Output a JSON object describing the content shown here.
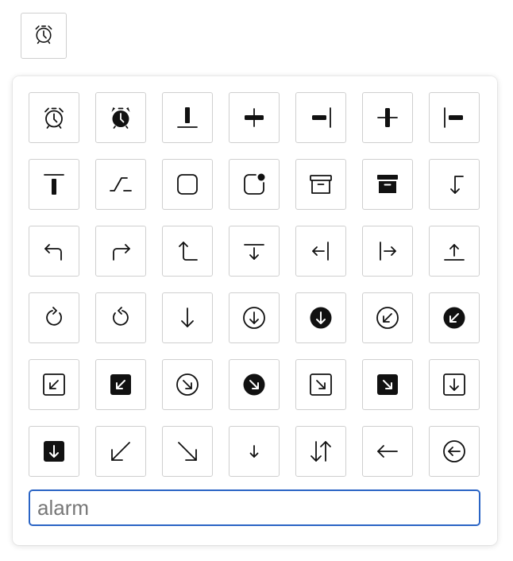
{
  "trigger": {
    "icon": "alarm-icon"
  },
  "search": {
    "placeholder": "alarm"
  },
  "icons": [
    "alarm",
    "alarm-fill",
    "align-bottom",
    "align-center",
    "align-end",
    "align-middle",
    "align-start",
    "align-top",
    "alt",
    "app",
    "app-indicator",
    "archive",
    "archive-fill",
    "arrow-90deg-down",
    "arrow-90deg-left",
    "arrow-90deg-right",
    "arrow-90deg-up",
    "arrow-bar-down",
    "arrow-bar-left",
    "arrow-bar-right",
    "arrow-bar-up",
    "arrow-clockwise",
    "arrow-counterclockwise",
    "arrow-down",
    "arrow-down-circle",
    "arrow-down-circle-fill",
    "arrow-down-left-circle",
    "arrow-down-left-circle-fill",
    "arrow-down-left-square",
    "arrow-down-left-square-fill",
    "arrow-down-right-circle",
    "arrow-down-right-circle-fill",
    "arrow-down-right-square",
    "arrow-down-right-square-fill",
    "arrow-down-square",
    "arrow-down-square-fill",
    "arrow-down-left",
    "arrow-down-right",
    "arrow-down-short",
    "arrow-down-up",
    "arrow-left",
    "arrow-left-circle"
  ]
}
